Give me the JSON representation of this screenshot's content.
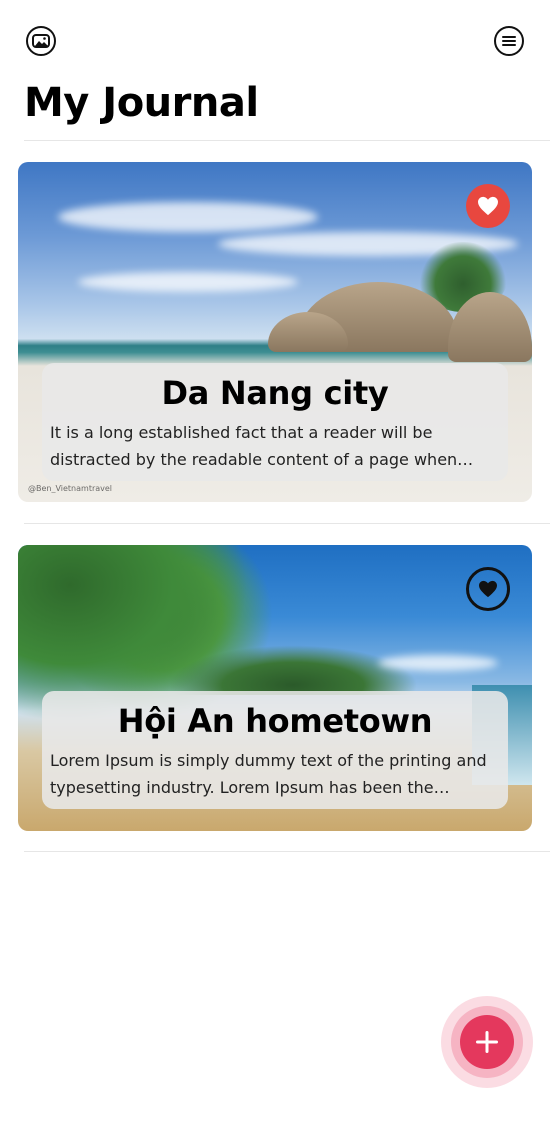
{
  "header": {
    "title": "My Journal",
    "left_icon": "photos-icon",
    "right_icon": "menu-icon"
  },
  "entries": [
    {
      "title": "Da Nang city",
      "excerpt": "It is a long established fact that a reader will be distracted by the readable content of a page when looking at its layout.",
      "favorite": true,
      "photo_credit": "@Ben_Vietnamtravel"
    },
    {
      "title": "Hội An hometown",
      "excerpt": "Lorem Ipsum is simply dummy text of the printing and typesetting industry. Lorem Ipsum has been the industry's standard dummy text.",
      "favorite": false
    }
  ],
  "fab": {
    "icon": "plus-icon"
  },
  "colors": {
    "favorite_active": "#e8473f",
    "fab": "#e4385d",
    "caption_bg": "#e8e8e8"
  }
}
